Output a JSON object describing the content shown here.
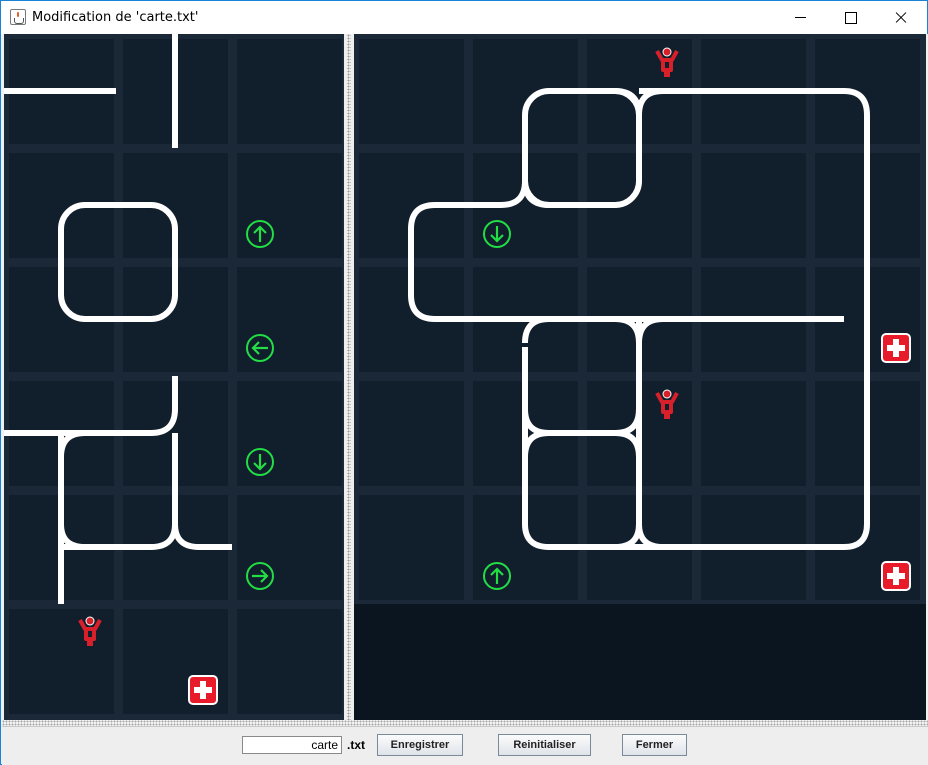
{
  "window": {
    "title": "Modification de 'carte.txt'"
  },
  "footer": {
    "filename_value": "carte",
    "extension_label": ".txt",
    "save_label": "Enregistrer",
    "reset_label": "Reinitialiser",
    "close_label": "Fermer"
  },
  "map_legend": {
    "tile_colors": {
      "background": "#0f1d2b",
      "tile": "#111e2c",
      "grid_line": "#1a2838",
      "empty_area": "#0a1520"
    },
    "road_color": "#ffffff",
    "arrow_color": "#22dd44",
    "hospital_color": "#e81b2a",
    "person_color": "#d8202a"
  },
  "icons": {
    "arrow_up": "arrow-up-icon",
    "arrow_down": "arrow-down-icon",
    "arrow_left": "arrow-left-icon",
    "arrow_right": "arrow-right-icon",
    "hospital": "hospital-cross-icon",
    "person": "person-icon"
  }
}
